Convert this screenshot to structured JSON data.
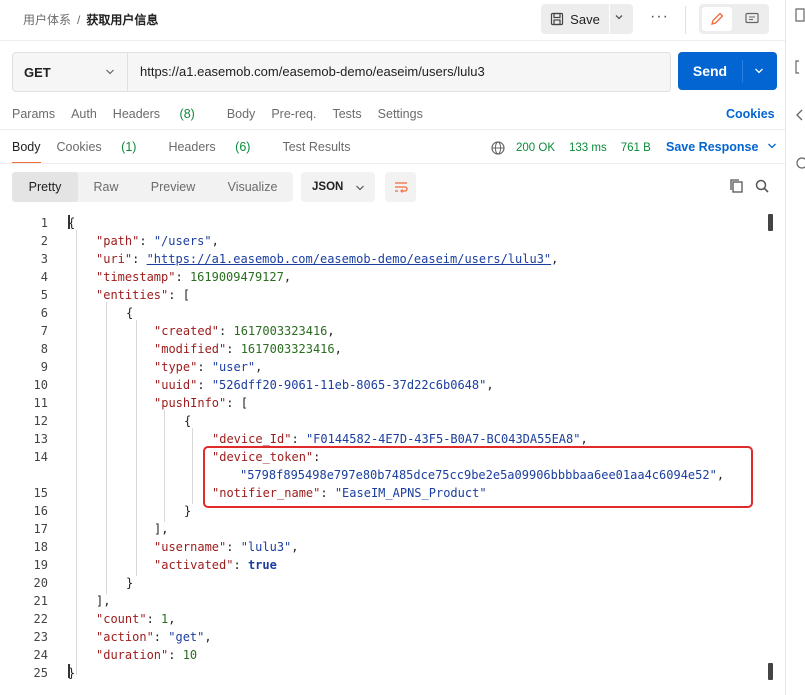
{
  "breadcrumb": {
    "parent": "用户体系",
    "separator": "/",
    "current": "获取用户信息"
  },
  "toolbar": {
    "save_label": "Save",
    "more_label": "···"
  },
  "request": {
    "method": "GET",
    "url": "https://a1.easemob.com/easemob-demo/easeim/users/lulu3",
    "send_label": "Send",
    "tabs": {
      "params": "Params",
      "auth": "Auth",
      "headers": "Headers",
      "headers_count": "(8)",
      "body": "Body",
      "prereq": "Pre-req.",
      "tests": "Tests",
      "settings": "Settings"
    },
    "cookies_label": "Cookies"
  },
  "response": {
    "tabs": {
      "body": "Body",
      "cookies": "Cookies",
      "cookies_count": "(1)",
      "headers": "Headers",
      "headers_count": "(6)",
      "test_results": "Test Results"
    },
    "status": "200 OK",
    "time": "133 ms",
    "size": "761 B",
    "save_response_label": "Save Response",
    "view_tabs": {
      "pretty": "Pretty",
      "raw": "Raw",
      "preview": "Preview",
      "visualize": "Visualize"
    },
    "format": "JSON"
  },
  "code": {
    "line_numbers": [
      "1",
      "2",
      "3",
      "4",
      "5",
      "6",
      "7",
      "8",
      "9",
      "10",
      "11",
      "12",
      "13",
      "14",
      "15",
      "16",
      "17",
      "18",
      "19",
      "20",
      "21",
      "22",
      "23",
      "24",
      "25"
    ],
    "path_key": "\"path\"",
    "path_val": "\"/users\"",
    "uri_key": "\"uri\"",
    "uri_val": "\"https://a1.easemob.com/easemob-demo/easeim/users/lulu3\"",
    "timestamp_key": "\"timestamp\"",
    "timestamp_val": "1619009479127",
    "entities_key": "\"entities\"",
    "created_key": "\"created\"",
    "created_val": "1617003323416",
    "modified_key": "\"modified\"",
    "modified_val": "1617003323416",
    "type_key": "\"type\"",
    "type_val": "\"user\"",
    "uuid_key": "\"uuid\"",
    "uuid_val": "\"526dff20-9061-11eb-8065-37d22c6b0648\"",
    "pushinfo_key": "\"pushInfo\"",
    "device_id_key": "\"device_Id\"",
    "device_id_val": "\"F0144582-4E7D-43F5-B0A7-BC043DA55EA8\"",
    "device_token_key": "\"device_token\"",
    "device_token_val": "\"5798f895498e797e80b7485dce75cc9be2e5a09906bbbbaa6ee01aa4c6094e52\"",
    "notifier_key": "\"notifier_name\"",
    "notifier_val": "\"EaseIM_APNS_Product\"",
    "username_key": "\"username\"",
    "username_val": "\"lulu3\"",
    "activated_key": "\"activated\"",
    "activated_val": "true",
    "count_key": "\"count\"",
    "count_val": "1",
    "action_key": "\"action\"",
    "action_val": "\"get\"",
    "duration_key": "\"duration\"",
    "duration_val": "10"
  },
  "colors": {
    "send": "#0265d2",
    "status_ok": "#0b8a3a",
    "highlight_box": "#e02b2b",
    "json_key": "#9c1b1b",
    "json_string": "#1b3fa0",
    "json_number": "#2a6d1f"
  }
}
